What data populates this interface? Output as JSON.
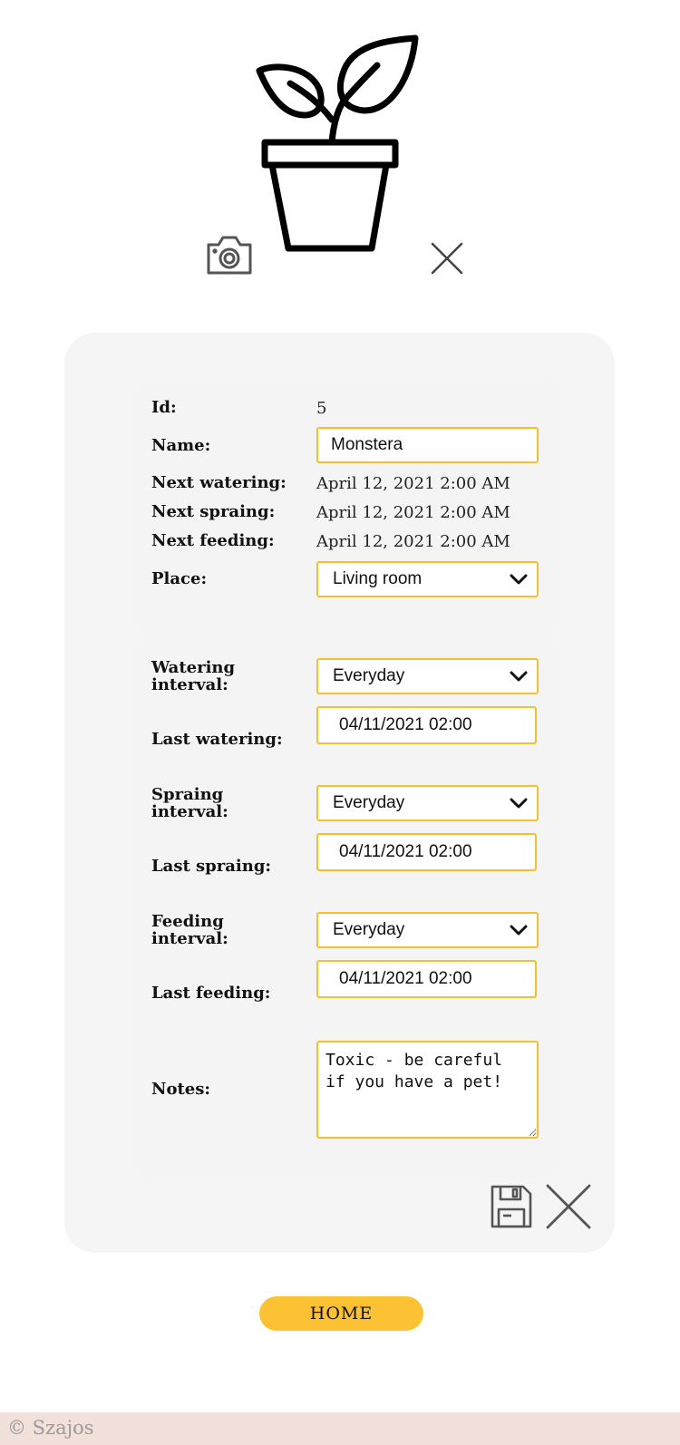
{
  "plant_icon": "potted-plant-icon",
  "photo_icon": "camera-icon",
  "remove_icon": "close-icon",
  "details": {
    "id_label": "Id:",
    "id_value": "5",
    "name_label": "Name:",
    "name_value": "Monstera",
    "next_watering_label": "Next watering:",
    "next_watering_value": "April 12, 2021 2:00 AM",
    "next_spraing_label": "Next spraing:",
    "next_spraing_value": "April 12, 2021 2:00 AM",
    "next_feeding_label": "Next feeding:",
    "next_feeding_value": "April 12, 2021 2:00 AM",
    "place_label": "Place:",
    "place_value": "Living room"
  },
  "care": {
    "watering_interval_label_1": "Watering",
    "watering_interval_label_2": "interval:",
    "watering_interval_value": "Everyday",
    "last_watering_label": "Last watering:",
    "last_watering_value": "04/11/2021 02:00",
    "spraing_interval_label_1": "Spraing",
    "spraing_interval_label_2": "interval:",
    "spraing_interval_value": "Everyday",
    "last_spraing_label": "Last spraing:",
    "last_spraing_value": "04/11/2021 02:00",
    "feeding_interval_label_1": "Feeding",
    "feeding_interval_label_2": "interval:",
    "feeding_interval_value": "Everyday",
    "last_feeding_label": "Last feeding:",
    "last_feeding_value": "04/11/2021 02:00",
    "notes_label": "Notes:",
    "notes_value": "Toxic - be careful if you have a pet!"
  },
  "actions": {
    "save_icon": "floppy-disk-icon",
    "cancel_icon": "close-icon"
  },
  "home_button": "HOME",
  "footer_text": "© Szajos",
  "colors": {
    "accent": "#fcc233",
    "field_border": "#f5bf30",
    "card_bg": "#f5f5f5",
    "footer_bg": "#f2e0da"
  }
}
